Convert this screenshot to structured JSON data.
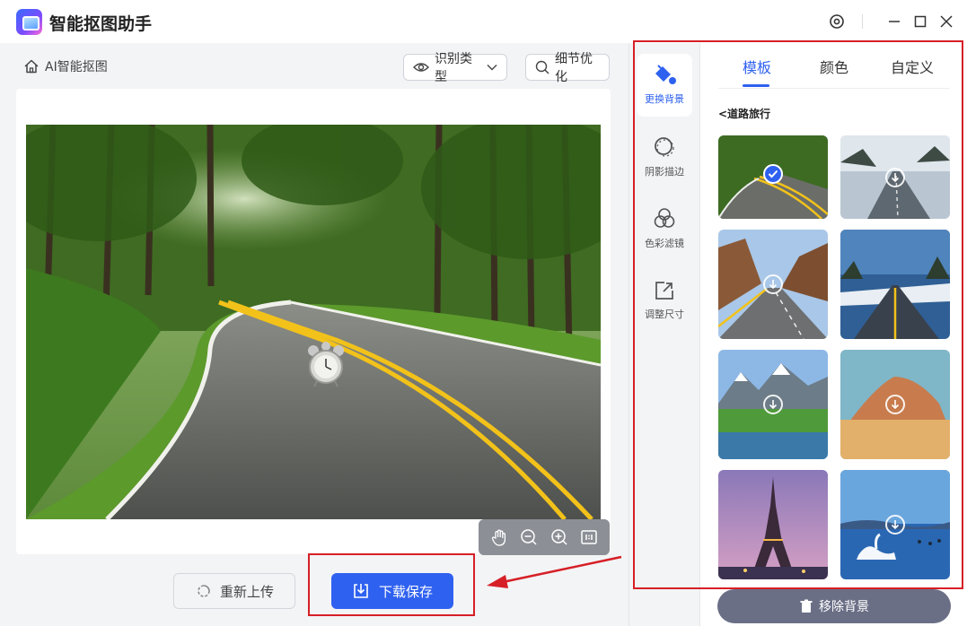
{
  "app": {
    "title": "智能抠图助手"
  },
  "breadcrumb": {
    "label": "AI智能抠图"
  },
  "toolbar": {
    "recognize_label": "识别类型",
    "refine_label": "细节优化"
  },
  "actions": {
    "reupload_label": "重新上传",
    "download_label": "下载保存"
  },
  "side_nav": {
    "items": [
      {
        "label": "更换背景",
        "icon": "paint-bucket-icon",
        "active": true
      },
      {
        "label": "阴影描边",
        "icon": "shadow-outline-icon",
        "active": false
      },
      {
        "label": "色彩滤镜",
        "icon": "color-filter-icon",
        "active": false
      },
      {
        "label": "调整尺寸",
        "icon": "resize-icon",
        "active": false
      }
    ]
  },
  "panel": {
    "tabs": [
      {
        "label": "模板",
        "active": true
      },
      {
        "label": "颜色",
        "active": false
      },
      {
        "label": "自定义",
        "active": false
      }
    ],
    "section_title": "<道路旅行",
    "thumbnails": [
      {
        "name": "forest-road",
        "selected": true
      },
      {
        "name": "snowy-road",
        "selected": false
      },
      {
        "name": "canyon-road",
        "selected": false
      },
      {
        "name": "winter-highway",
        "selected": false
      },
      {
        "name": "mountain-lake",
        "selected": false
      },
      {
        "name": "desert-rock",
        "selected": false
      },
      {
        "name": "eiffel-tower",
        "selected": false
      },
      {
        "name": "swan-lake",
        "selected": false
      }
    ],
    "remove_label": "移除背景"
  },
  "colors": {
    "accent": "#2f61f0",
    "annotation": "#d61f26"
  }
}
